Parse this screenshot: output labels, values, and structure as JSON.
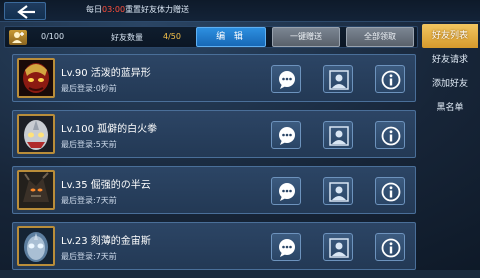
{
  "header": {
    "notice_prefix": "每日",
    "notice_time": "03:00",
    "notice_suffix": "重置好友体力赠送"
  },
  "stats": {
    "requests_count": "0/100",
    "friends_label": "好友数量",
    "friends_count": "4/50"
  },
  "actions": {
    "edit_label": "编 辑",
    "gift_all_label": "一键赠送",
    "claim_all_label": "全部领取"
  },
  "tabs": [
    {
      "label": "好友列表",
      "active": true
    },
    {
      "label": "好友请求",
      "active": false
    },
    {
      "label": "添加好友",
      "active": false
    },
    {
      "label": "黑名单",
      "active": false
    }
  ],
  "friends": [
    {
      "name": "Lv.90  活泼的蓝异形",
      "last_login": "最后登录:0秒前",
      "avatar_color": "#8b1a12"
    },
    {
      "name": "Lv.100  孤僻的白火拳",
      "last_login": "最后登录:5天前",
      "avatar_color": "#c9ccd2"
    },
    {
      "name": "Lv.35  倔强的の半云",
      "last_login": "最后登录:7天前",
      "avatar_color": "#3b3128"
    },
    {
      "name": "Lv.23  刻薄的金宙斯",
      "last_login": "最后登录:7天前",
      "avatar_color": "#5d7fa0"
    }
  ],
  "colors": {
    "accent_blue": "#1f7fd0",
    "tab_active": "#e2ab40",
    "highlight_red": "#ff4f3b",
    "count_yellow": "#f6c24a"
  },
  "icons": [
    "back-icon",
    "add-friend-icon",
    "chat-icon",
    "profile-icon",
    "info-icon"
  ]
}
